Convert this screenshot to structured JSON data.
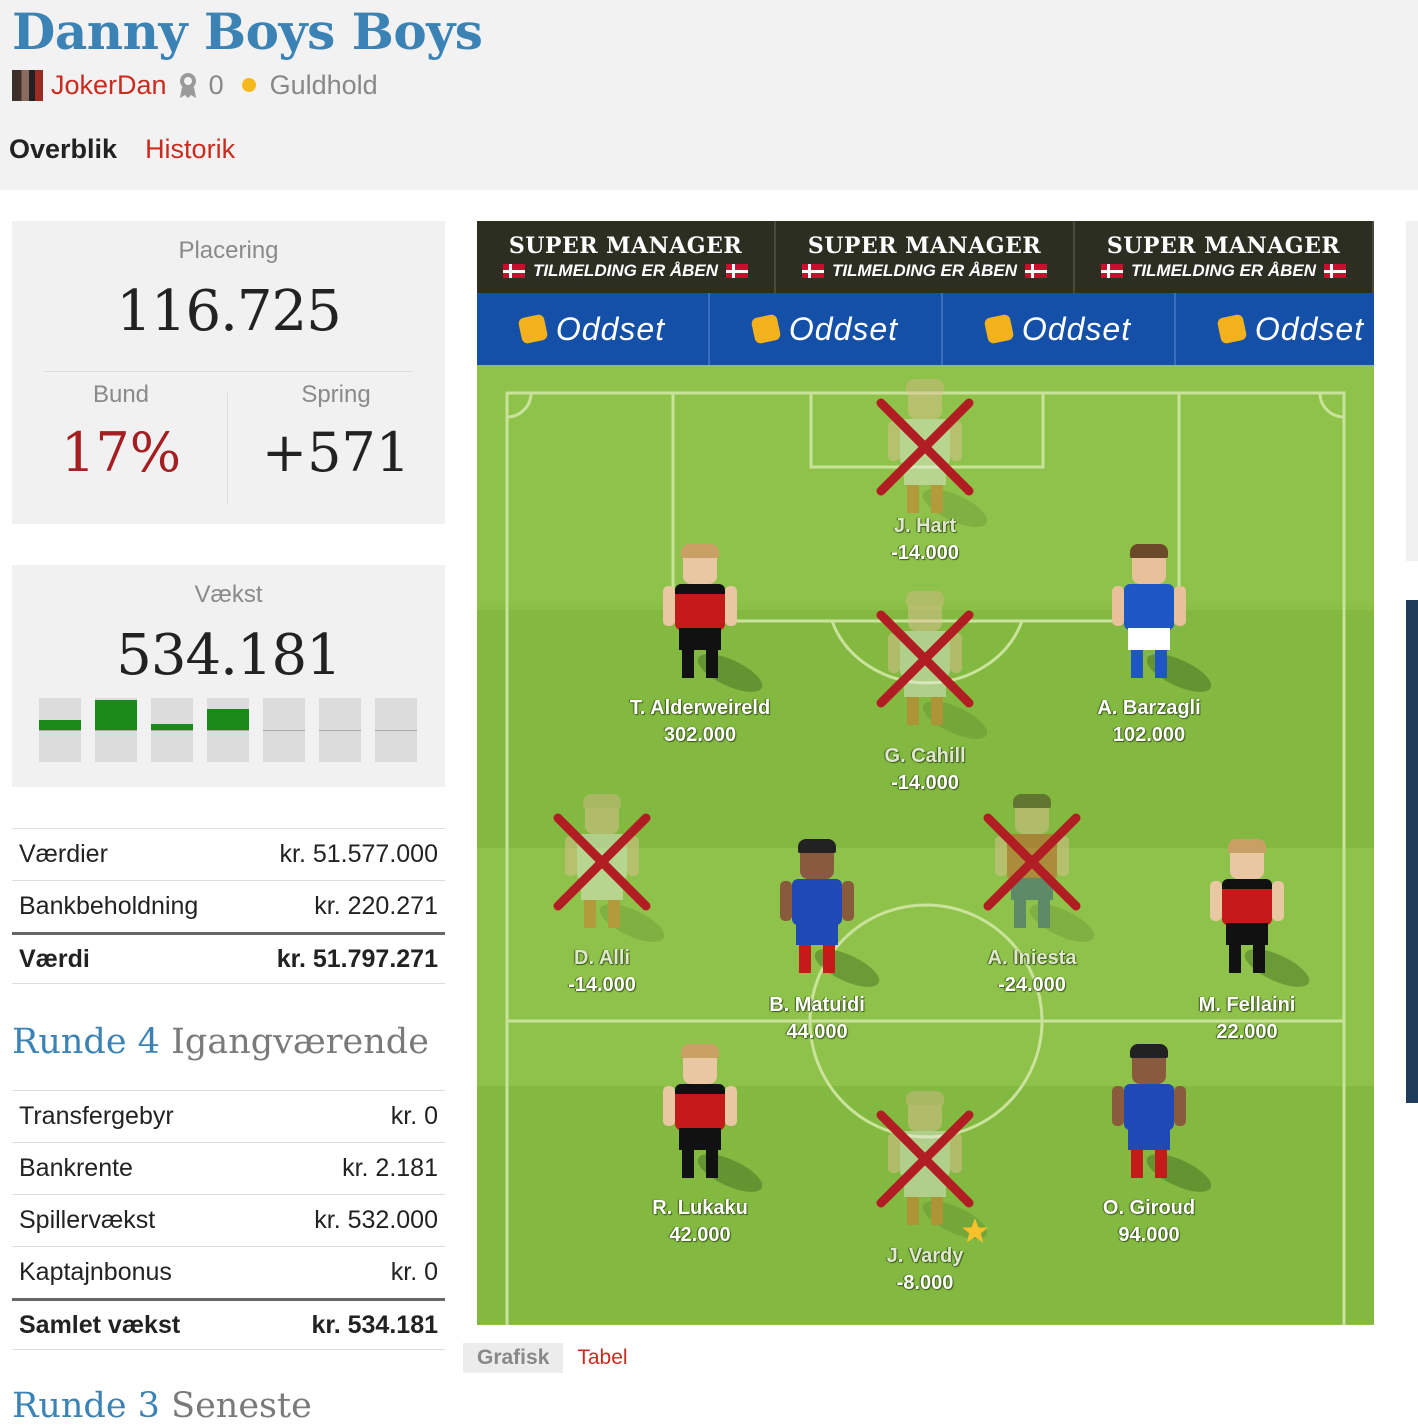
{
  "header": {
    "team_name": "Danny Boys Boys",
    "username": "JokerDan",
    "trophies": "0",
    "level": "Guldhold",
    "tabs": [
      {
        "label": "Overblik",
        "active": true
      },
      {
        "label": "Historik",
        "active": false
      }
    ]
  },
  "ranking": {
    "label": "Placering",
    "value": "116.725",
    "bottom_label": "Bund",
    "bottom_value": "17%",
    "jump_label": "Spring",
    "jump_value": "+571"
  },
  "growth": {
    "label": "Vækst",
    "value": "534.181",
    "bars": [
      0.3,
      0.95,
      0.2,
      0.65,
      0,
      0,
      0
    ]
  },
  "values_table": {
    "rows": [
      {
        "label": "Værdier",
        "value": "kr. 51.577.000"
      },
      {
        "label": "Bankbeholdning",
        "value": "kr. 220.271"
      }
    ],
    "total": {
      "label": "Værdi",
      "value": "kr. 51.797.271"
    }
  },
  "round_current": {
    "lead": "Runde 4",
    "rest": "Igangværende",
    "rows": [
      {
        "label": "Transfergebyr",
        "value": "kr. 0"
      },
      {
        "label": "Bankrente",
        "value": "kr. 2.181"
      },
      {
        "label": "Spillervækst",
        "value": "kr. 532.000"
      },
      {
        "label": "Kaptajnbonus",
        "value": "kr. 0"
      }
    ],
    "total": {
      "label": "Samlet vækst",
      "value": "kr. 534.181"
    }
  },
  "round_previous": {
    "lead": "Runde 3",
    "rest": "Seneste"
  },
  "ads": {
    "banner1_line1": "SUPER MANAGER",
    "banner1_line2": "TILMELDING ER ÅBEN",
    "banner2_text": "Oddset"
  },
  "players": {
    "gk": {
      "name": "J. Hart",
      "score": "-14.000",
      "out": true,
      "kit": "england"
    },
    "d1": {
      "name": "T. Alderweireld",
      "score": "302.000",
      "out": false,
      "kit": "belgium"
    },
    "d2": {
      "name": "G. Cahill",
      "score": "-14.000",
      "out": true,
      "kit": "england"
    },
    "d3": {
      "name": "A. Barzagli",
      "score": "102.000",
      "out": false,
      "kit": "italy"
    },
    "m1": {
      "name": "D. Alli",
      "score": "-14.000",
      "out": true,
      "kit": "england"
    },
    "m2": {
      "name": "B. Matuidi",
      "score": "44.000",
      "out": false,
      "kit": "france"
    },
    "m3": {
      "name": "A. Iniesta",
      "score": "-24.000",
      "out": true,
      "kit": "spain"
    },
    "m4": {
      "name": "M. Fellaini",
      "score": "22.000",
      "out": false,
      "kit": "belgium"
    },
    "f1": {
      "name": "R. Lukaku",
      "score": "42.000",
      "out": false,
      "kit": "belgium"
    },
    "f2": {
      "name": "J. Vardy",
      "score": "-8.000",
      "out": true,
      "kit": "england",
      "captain": true
    },
    "f3": {
      "name": "O. Giroud",
      "score": "94.000",
      "out": false,
      "kit": "france"
    }
  },
  "view_tabs": [
    {
      "label": "Grafisk",
      "active": true
    },
    {
      "label": "Tabel",
      "active": false
    }
  ],
  "colors": {
    "brand_blue": "#3b82b5",
    "link_red": "#cc2a1e",
    "pitch_green": "#8cbf45",
    "growth_green": "#1a8a1a",
    "cross_red": "#b01e23"
  }
}
